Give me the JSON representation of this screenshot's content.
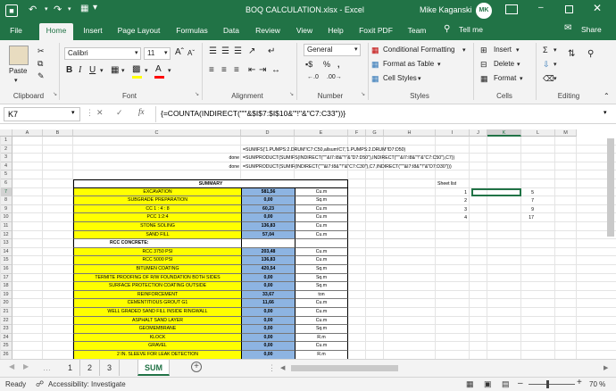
{
  "title_bar": {
    "title": "BOQ CALCULATION.xlsx  -  Excel",
    "user": "Mike Kaganski",
    "user_initials": "MK"
  },
  "ribbon_tabs": [
    "File",
    "Home",
    "Insert",
    "Page Layout",
    "Formulas",
    "Data",
    "Review",
    "View",
    "Help",
    "Foxit PDF",
    "Team"
  ],
  "tell_me": "Tell me",
  "share": "Share",
  "ribbon": {
    "paste": "Paste",
    "clipboard": "Clipboard",
    "font_name": "Calibri",
    "font_size": "11",
    "font": "Font",
    "alignment": "Alignment",
    "number_format": "General",
    "number": "Number",
    "conditional_formatting": "Conditional Formatting",
    "format_as_table": "Format as Table",
    "cell_styles": "Cell Styles",
    "styles": "Styles",
    "insert": "Insert",
    "delete": "Delete",
    "format": "Format",
    "cells": "Cells",
    "editing": "Editing"
  },
  "formula_bar": {
    "name_box": "K7",
    "formula": "{=COUNTA(INDIRECT(\"'\"&$I$7:$I$10&\"'!\"&\"C7:C33\"))}"
  },
  "columns": [
    "A",
    "B",
    "C",
    "D",
    "E",
    "F",
    "G",
    "H",
    "I",
    "J",
    "K",
    "L",
    "M"
  ],
  "rows": [
    "1",
    "2",
    "3",
    "4",
    "5",
    "6",
    "7",
    "8",
    "9",
    "10",
    "11",
    "12",
    "13",
    "14",
    "15",
    "16",
    "17",
    "18",
    "19",
    "20",
    "21",
    "22",
    "23",
    "24",
    "25",
    "26"
  ],
  "formulas_text": {
    "row2": "=SUMIFS('1.PUMPS:2.DRUM'!C7:C50,allsum!C7,'1.PUMPS:2.DRUM'!D7:D50)",
    "row3_label": "done",
    "row3": "=SUMPRODUCT(SUMIFS(INDIRECT(\"'\"&I7:I8&\"'!\"&\"D7:D50\"),INDIRECT(\"'\"&I7:I8&\"'!\"&\"C7:C50\"),C7))",
    "row4_label": "done",
    "row4": "=SUMPRODUCT(SUMIF(INDIRECT(\"'\"&I7:I8&\"'!\"&\"C7:C30\"),C7,INDIRECT(\"'\"&I7:I8&\"'!\"&\"D7:D30\")))"
  },
  "summary_header": "SUMMARY",
  "table_rows": [
    {
      "item": "EXCAVATION",
      "qty": "581,56",
      "unit": "Cu.m"
    },
    {
      "item": "SUBGRADE PREPARATION",
      "qty": "0,00",
      "unit": "Sq.m"
    },
    {
      "item": "CC 1 : 4 : 8",
      "qty": "60,23",
      "unit": "Cu.m"
    },
    {
      "item": "PCC 1:2:4",
      "qty": "0,00",
      "unit": "Cu.m"
    },
    {
      "item": "STONE SOLING",
      "qty": "136,83",
      "unit": "Cu.m"
    },
    {
      "item": "SAND FILL",
      "qty": "57,04",
      "unit": "Cu.m"
    },
    {
      "item": "RCC CONCRETE:",
      "qty": "",
      "unit": ""
    },
    {
      "item": "RCC 3750 PSI",
      "qty": "203,48",
      "unit": "Cu.m"
    },
    {
      "item": "RCC 5000 PSI",
      "qty": "136,83",
      "unit": "Cu.m"
    },
    {
      "item": "BITUMEN COATING",
      "qty": "420,54",
      "unit": "Sq.m"
    },
    {
      "item": "TERMITE PROOFING OF R/W FOUNDATION BOTH SIDES",
      "qty": "0,00",
      "unit": "Sq.m"
    },
    {
      "item": "SURFACE PROTECTION COATING OUTSIDE",
      "qty": "0,00",
      "unit": "Sq.m"
    },
    {
      "item": "REINFORCEMENT",
      "qty": "33,67",
      "unit": "ton"
    },
    {
      "item": "CEMENTITIOUS GROUT G1",
      "qty": "11,66",
      "unit": "Cu.m"
    },
    {
      "item": "WELL GRADED SAND FILL INSIDE RINGWALL",
      "qty": "0,00",
      "unit": "Cu.m"
    },
    {
      "item": "ASPHALT SAND LAYER",
      "qty": "0,00",
      "unit": "Cu.m"
    },
    {
      "item": "GEOMEMBRANE",
      "qty": "0,00",
      "unit": "Sq.m"
    },
    {
      "item": "KLOCK",
      "qty": "0,00",
      "unit": "R.m"
    },
    {
      "item": "GRAVEL",
      "qty": "0,00",
      "unit": "Cu.m"
    },
    {
      "item": "2 IN. SLEEVE FOR LEAK DETECTION",
      "qty": "0,00",
      "unit": "R.m"
    }
  ],
  "sheet_list": {
    "header": "Sheet list",
    "idx": [
      "1",
      "2",
      "3",
      "4"
    ],
    "counts": [
      "5",
      "7",
      "9",
      "17"
    ]
  },
  "sheet_tabs": [
    "1",
    "2",
    "3",
    "SUM"
  ],
  "status": {
    "ready": "Ready",
    "accessibility": "Accessibility: Investigate",
    "zoom": "70 %"
  }
}
